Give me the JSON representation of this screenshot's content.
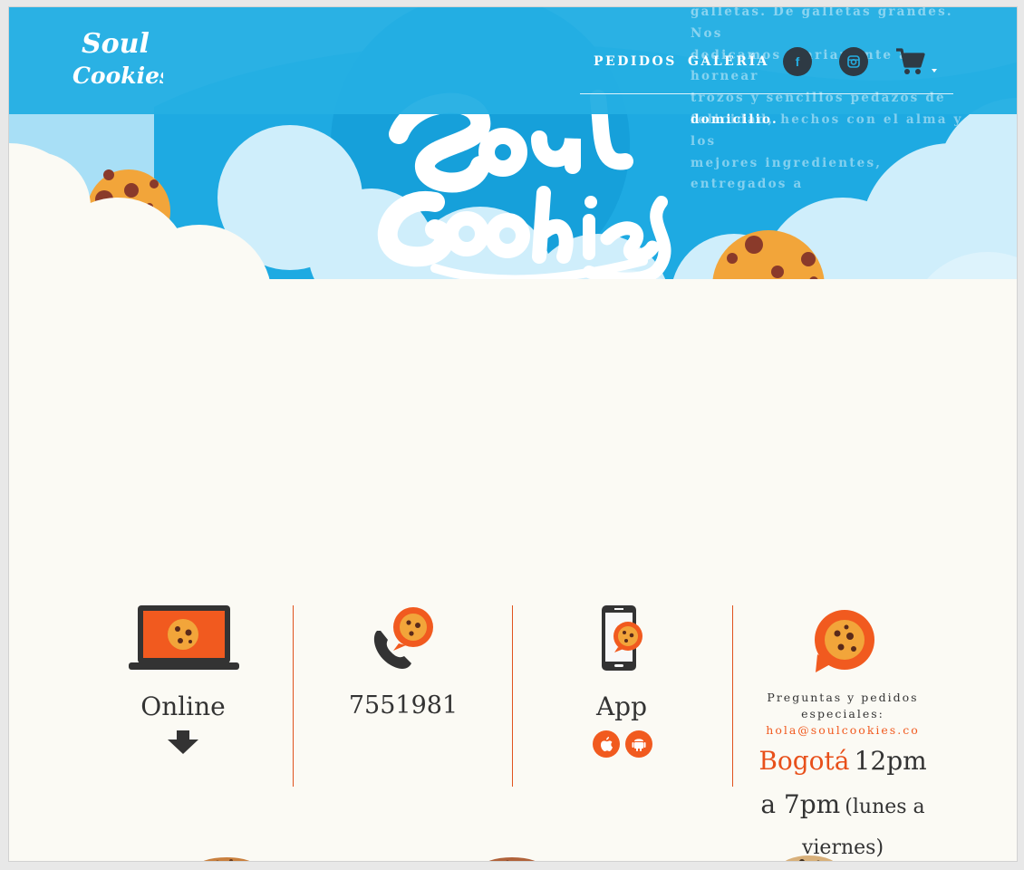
{
  "brand": {
    "logo_text_line1": "Soul",
    "logo_text_line2": "Cookies",
    "colors": {
      "sky": "#24afe3",
      "accent": "#f15a1f",
      "dark": "#2e3a44",
      "cream": "#fbfaf4"
    }
  },
  "header": {
    "nav": [
      {
        "label": "PEDIDOS"
      },
      {
        "label": "GALERÍA"
      }
    ],
    "social": [
      {
        "icon": "facebook-icon",
        "glyph": "f"
      },
      {
        "icon": "instagram-icon"
      }
    ],
    "cart_icon": "cart-icon"
  },
  "tagline": {
    "lines": [
      "galletas. De galletas grandes. Nos",
      "dedicamos diariamente a hornear",
      "trozos y sencillos pedazos de",
      "felicidad, hechos con el alma y los",
      "mejores ingredientes, entregados a"
    ],
    "last": "domicilio."
  },
  "features": {
    "online": {
      "label": "Online",
      "icon": "laptop-cookie-icon",
      "arrow_icon": "down-arrow-icon"
    },
    "phone": {
      "label": "7551981",
      "icon": "phone-cookie-icon"
    },
    "app": {
      "label": "App",
      "icon": "smartphone-cookie-icon",
      "badges": [
        "apple-icon",
        "android-icon"
      ]
    },
    "contact": {
      "icon": "chat-cookie-icon",
      "text": "Preguntas y pedidos especiales:",
      "email": "hola@soulcookies.co",
      "city": "Bogotá",
      "time": "12pm a 7pm",
      "days": "(lunes a viernes)"
    }
  }
}
